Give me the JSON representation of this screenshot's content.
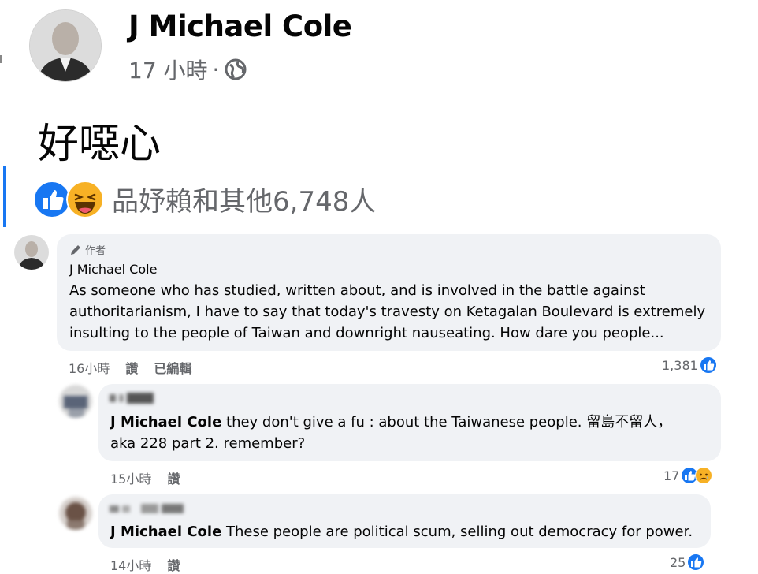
{
  "post": {
    "author": "J Michael Cole",
    "time": "17 小時",
    "separator": "·",
    "text": "好噁心",
    "reaction_summary": "品妤賴和其他6,748人"
  },
  "comments": [
    {
      "author_badge": "作者",
      "author": "J Michael Cole",
      "text": "As someone who has studied, written about, and is involved in the battle against authoritarianism, I have to say that today's travesty on Ketagalan Boulevard is extremely insulting to the people of Taiwan and downright nauseating. How dare you people...",
      "line1": "As someone who has studied, written about, and is involved in the battle against",
      "line2": "authoritarianism, I have to say that today's travesty on Ketagalan Boulevard is extremely",
      "line3": "insulting to the people of Taiwan and downright nauseating. How dare you people...",
      "time": "16小時",
      "like": "讚",
      "edited": "已編輯",
      "reaction_count": "1,381"
    },
    {
      "author": "",
      "mention": "J Michael Cole",
      "line1": "they don't give a fu   : about the Taiwanese people. 留島不留人，",
      "line2": "aka 228 part 2. remember?",
      "time": "15小時",
      "like": "讚",
      "reaction_count": "17"
    },
    {
      "author": "",
      "mention": "J Michael Cole",
      "line1": "These people are political scum, selling out democracy for power.",
      "time": "14小時",
      "like": "讚",
      "reaction_count": "25"
    }
  ],
  "icons": {
    "like": "like-icon",
    "haha": "haha-icon",
    "sad": "sad-icon",
    "globe": "globe-icon",
    "pencil": "pencil-icon"
  },
  "colors": {
    "facebook_blue": "#1877f2",
    "bubble_bg": "#f0f2f5",
    "secondary_text": "#65676b",
    "haha_yellow": "#f7b125"
  }
}
